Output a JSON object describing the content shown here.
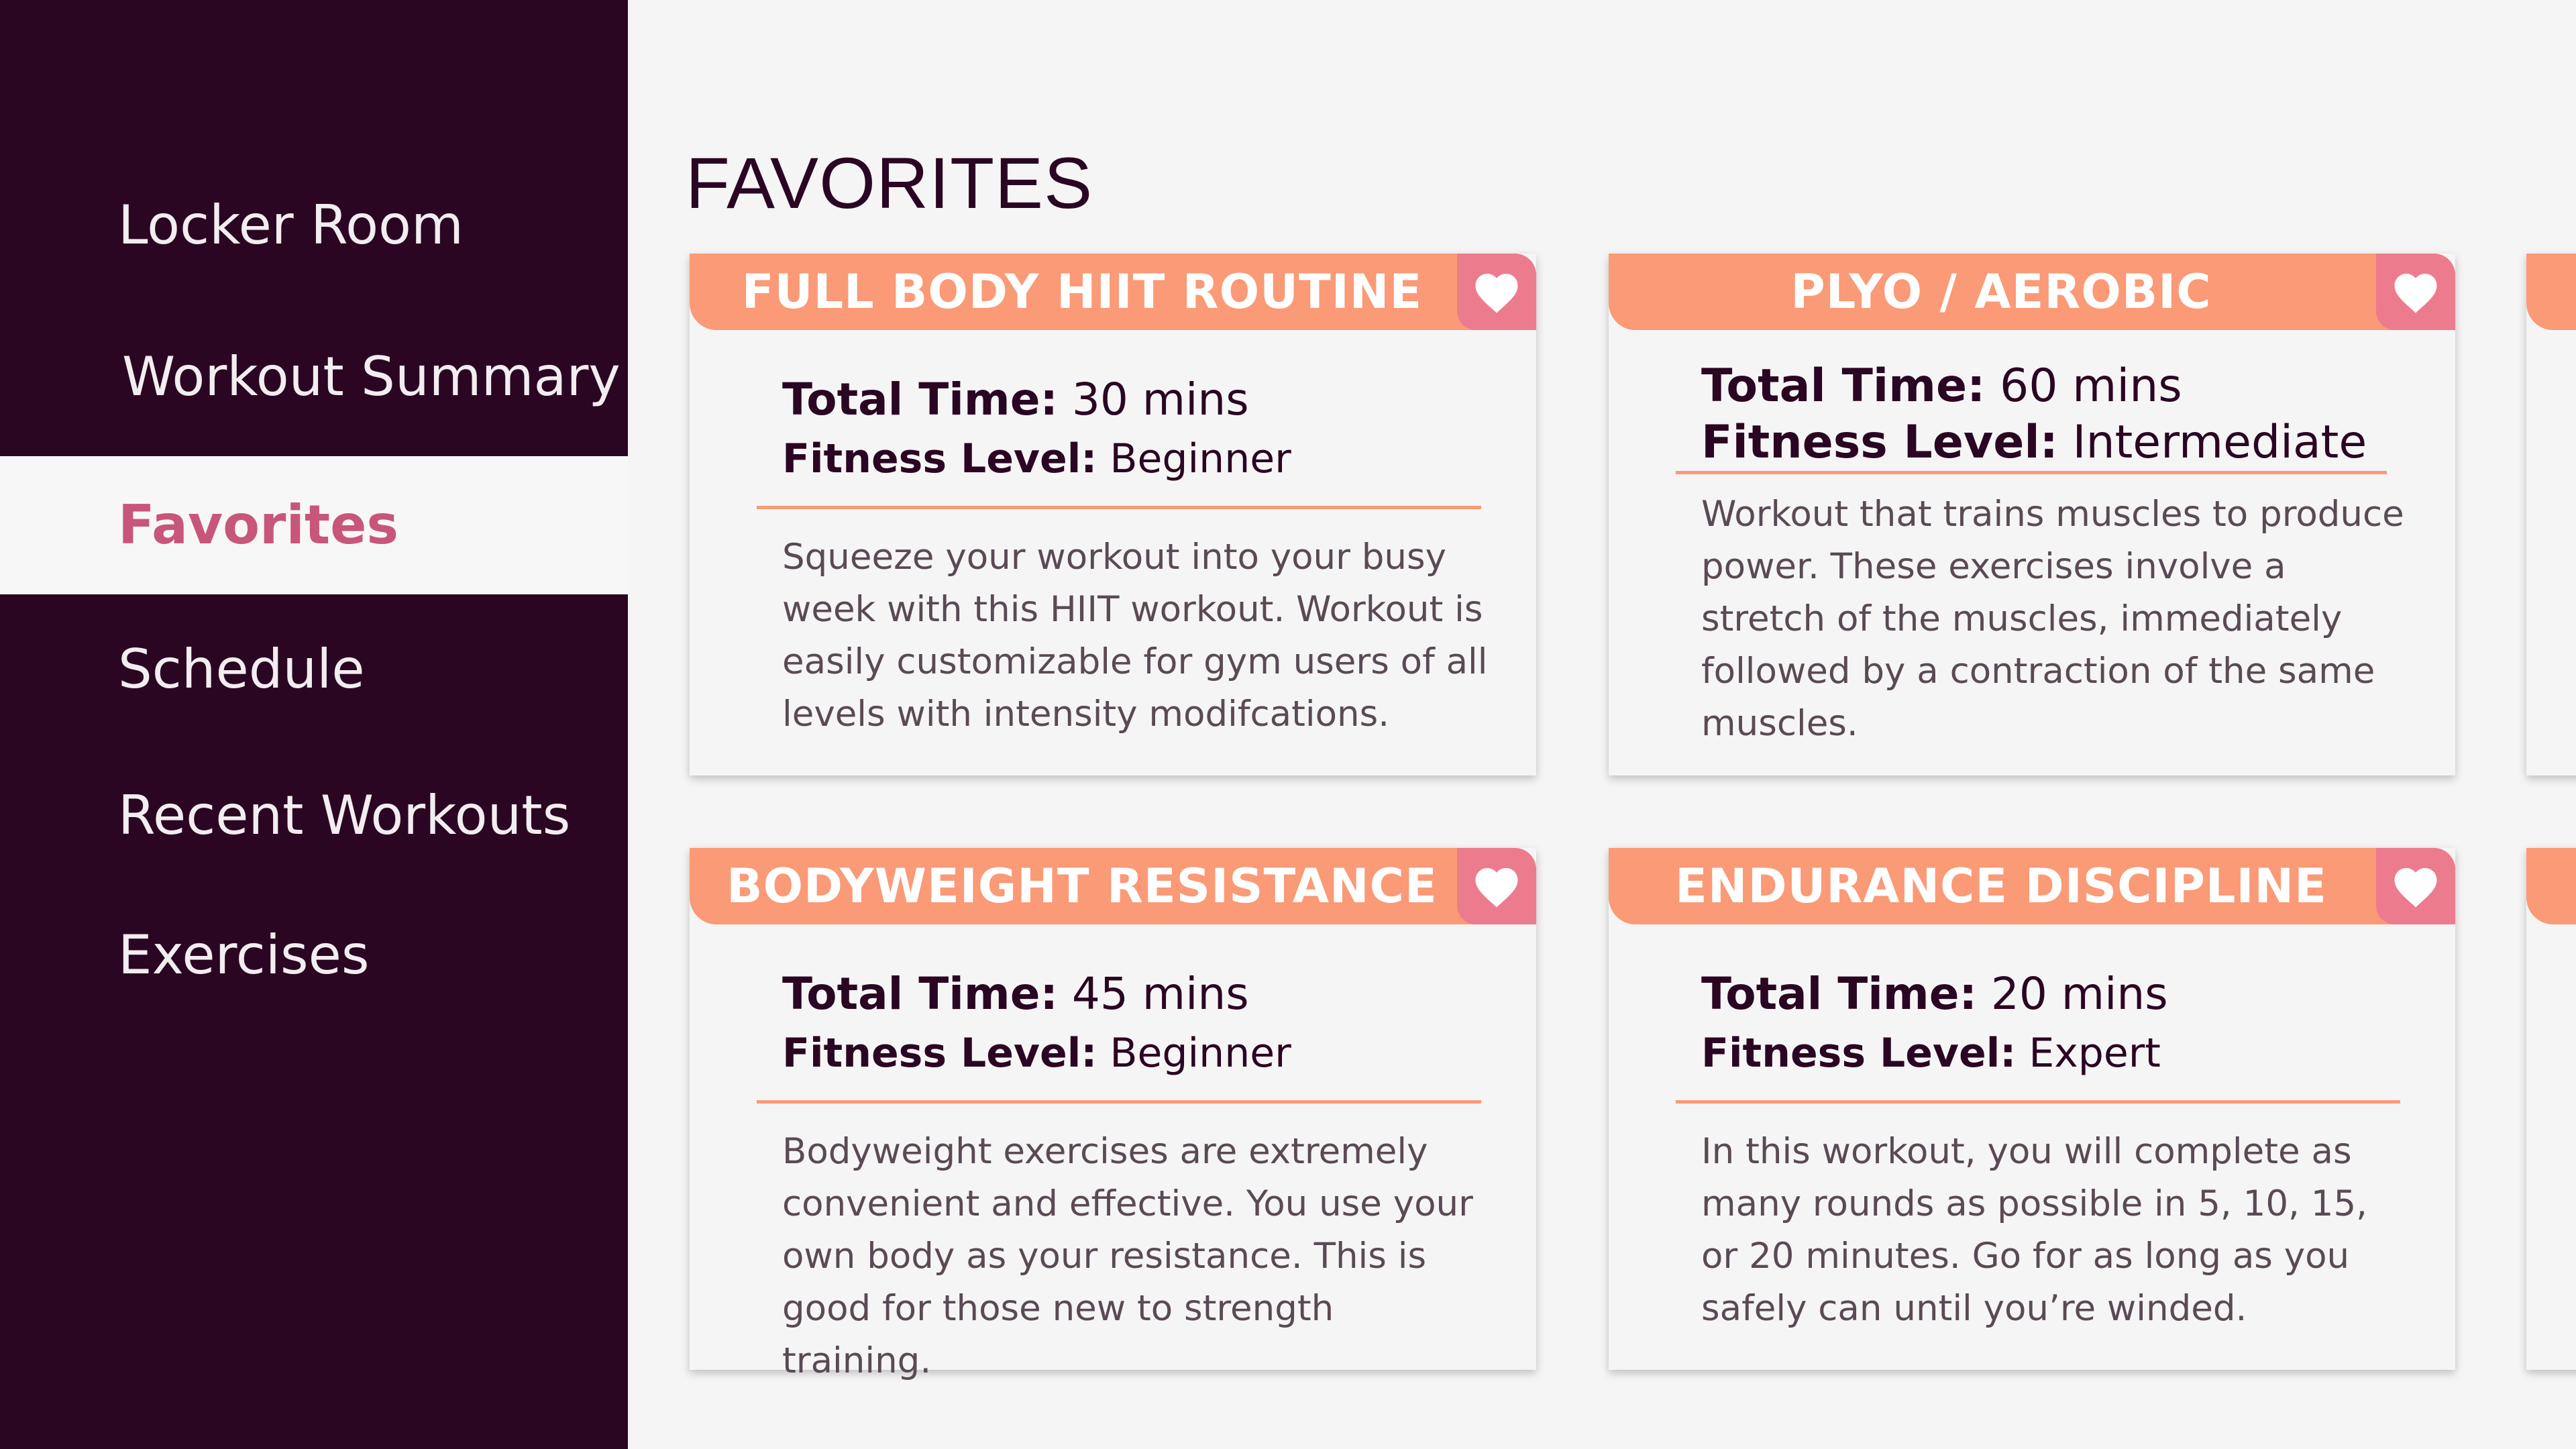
{
  "sidebar": {
    "items": [
      {
        "label": "Locker Room"
      },
      {
        "label": "Workout Summary"
      },
      {
        "label": "Favorites"
      },
      {
        "label": "Schedule"
      },
      {
        "label": "Recent Workouts"
      },
      {
        "label": "Exercises"
      }
    ],
    "active_index": 2
  },
  "main": {
    "title": "FAVORITES",
    "labels": {
      "total_time": "Total Time:",
      "fitness_level": "Fitness Level:"
    },
    "cards": [
      {
        "title": "FULL BODY HIIT ROUTINE",
        "total_time": "30 mins",
        "fitness_level": "Beginner",
        "description": "Squeeze your workout into your busy week with this HIIT workout. Workout is easily customizable for gym users of all levels with intensity modifcations.",
        "favorited": true
      },
      {
        "title": "PLYO / AEROBIC",
        "total_time": "60 mins",
        "fitness_level": "Intermediate",
        "description": "Workout that trains muscles to produce power. These exercises involve a stretch of the muscles, immediately followed by a contraction of the same muscles.",
        "favorited": true
      },
      {
        "title": "BODYWEIGHT RESISTANCE",
        "total_time": "45 mins",
        "fitness_level": "Beginner",
        "description": "Bodyweight exercises are extremely convenient and effective. You use your own body as your resistance. This is good for those new to strength training.",
        "favorited": true
      },
      {
        "title": "ENDURANCE DISCIPLINE",
        "total_time": "20 mins",
        "fitness_level": "Expert",
        "description": "In this workout, you will complete as many rounds as possible in 5, 10, 15, or 20 minutes. Go for as long as you safely can until you’re winded.",
        "favorited": true
      }
    ]
  },
  "icons": {
    "favorite": "heart-icon"
  },
  "colors": {
    "sidebar_bg": "#2b0622",
    "accent_orange": "#fa9a76",
    "favorite_pink": "#ed7b8e",
    "active_text": "#c8567a"
  }
}
